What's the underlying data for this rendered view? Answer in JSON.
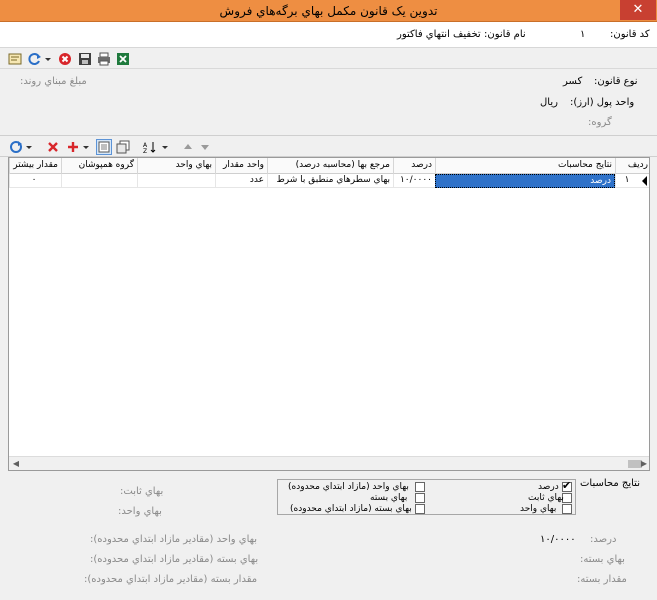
{
  "window": {
    "title": "تدوين يک قانون مکمل بهاي برگه‌هاي فروش",
    "close_glyph": "✕"
  },
  "header": {
    "code_label": "کد قانون:",
    "code_value": "۱",
    "name_label": "نام قانون:",
    "name_value": "تخفيف انتهاي فاکتور"
  },
  "info": {
    "type_label": "نوع قانون:",
    "type_value": "کسر",
    "currency_label": "واحد پول (ارز):",
    "currency_value": "ريال",
    "rounding_label": "مبلغ مبناي روند:",
    "group_label": "گروه:"
  },
  "grid": {
    "columns": [
      "رديف",
      "نتايج محاسبات",
      "درصد",
      "مرجع بها (محاسبه درصد)",
      "واحد مقدار",
      "بهاي واحد",
      "گروه همپوشان",
      "مقدار بيشتر"
    ],
    "rows": [
      [
        "۱",
        "درصد",
        "۱۰/۰۰۰۰",
        "بهاي سطرهاي منطبق با شرط",
        "عدد",
        "",
        "",
        "۰"
      ]
    ]
  },
  "results": {
    "section_label": "نتايج محاسبات",
    "options": [
      {
        "label": "درصد",
        "checked": true
      },
      {
        "label": "بهاي ثابت",
        "checked": false
      },
      {
        "label": "بهاي واحد",
        "checked": false
      },
      {
        "label": "بهاي واحد (مازاد ابتداي محدوده)",
        "checked": false
      },
      {
        "label": "بهاي بسته",
        "checked": false
      },
      {
        "label": "بهاي بسته (مازاد ابتداي محدوده)",
        "checked": false
      }
    ]
  },
  "summary": {
    "fixed_price_label": "بهاي ثابت:",
    "unit_price_label": "بهاي واحد:",
    "percent_label": "درصد:",
    "percent_value": "۱۰/۰۰۰۰",
    "unit_price_excess_label": "بهاي واحد (مقادير مازاد ابتداي محدوده):",
    "package_price_label": "بهاي بسته:",
    "package_price_excess_label": "بهاي بسته (مقادير مازاد ابتداي محدوده):",
    "package_qty_label": "مقدار بسته:",
    "package_qty_excess_label": "مقدار بسته (مقادير مازاد ابتداي محدوده):"
  },
  "colors": {
    "titlebar": "#ee8e42",
    "close": "#c84031",
    "selection": "#2f72c9"
  }
}
